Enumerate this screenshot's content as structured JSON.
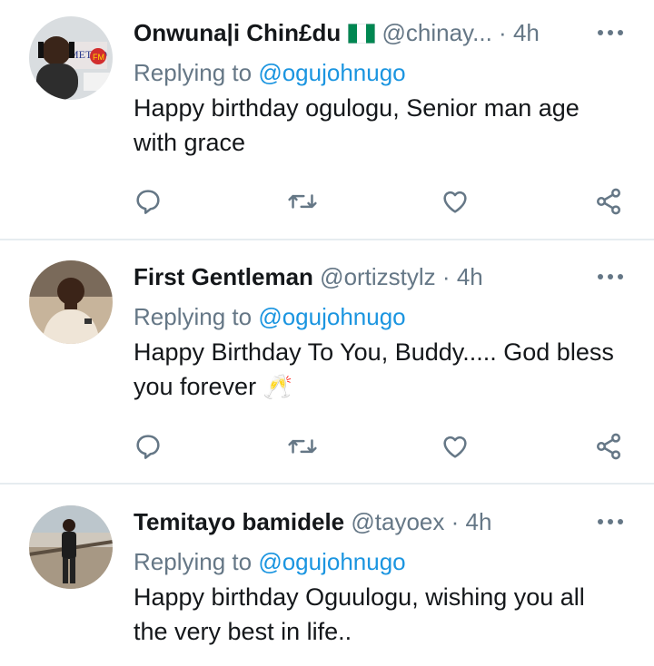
{
  "tweets": [
    {
      "name": "Onwuna|i Chin£du",
      "flag_icon": "nigeria-flag-icon",
      "handle": "@chinay...",
      "separator": "·",
      "time": "4h",
      "replying_prefix": "Replying to",
      "replying_to": "@ogujohnugo",
      "text_line1": "Happy birthday ogulogu, Senior man age",
      "text_line2": "with grace",
      "avatar_icon": "avatar-radio-presenter"
    },
    {
      "name": "First Gentleman",
      "handle": "@ortizstylz",
      "separator": "·",
      "time": "4h",
      "replying_prefix": "Replying to",
      "replying_to": "@ogujohnugo",
      "text_line1": "Happy Birthday To You, Buddy..... God bless",
      "text_line2": "you forever",
      "emoji": "🥂",
      "avatar_icon": "avatar-man-white-shirt"
    },
    {
      "name": "Temitayo bamidele",
      "handle": "@tayoex",
      "separator": "·",
      "time": "4h",
      "replying_prefix": "Replying to",
      "replying_to": "@ogujohnugo",
      "text_line1": "Happy birthday Oguulogu, wishing you all",
      "text_line2": "the very best in life..",
      "avatar_icon": "avatar-man-standing-outdoors"
    }
  ],
  "actions": [
    "reply-icon",
    "retweet-icon",
    "like-icon",
    "share-icon"
  ],
  "colors": {
    "text": "#14171a",
    "secondary": "#657786",
    "link": "#1b95e0",
    "divider": "#e6ecf0",
    "nigeria_green": "#008751"
  }
}
